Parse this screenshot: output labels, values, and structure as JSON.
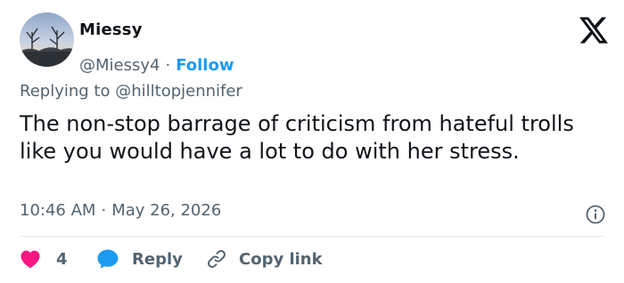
{
  "author": {
    "name": "Miessy",
    "handle": "@Miessy4",
    "separator": "·",
    "follow_label": "Follow"
  },
  "reply_to": {
    "prefix": "Replying to",
    "mention": "@hilltopjennifer"
  },
  "tweet": {
    "text": "The non-stop barrage of criticism from hateful trolls like you would have a lot to do with her stress."
  },
  "meta": {
    "time": "10:46 AM",
    "separator": "·",
    "date": "May 26, 2026"
  },
  "actions": {
    "like_count": "4",
    "reply_label": "Reply",
    "copy_label": "Copy link"
  },
  "colors": {
    "link": "#1d9bf0",
    "heart": "#f91880",
    "reply_bubble": "#1d9bf0",
    "secondary_text": "#536471"
  },
  "icons": {
    "brand": "x-logo-icon",
    "like": "heart-icon",
    "reply": "reply-bubble-icon",
    "copy": "link-icon",
    "info": "info-icon"
  }
}
